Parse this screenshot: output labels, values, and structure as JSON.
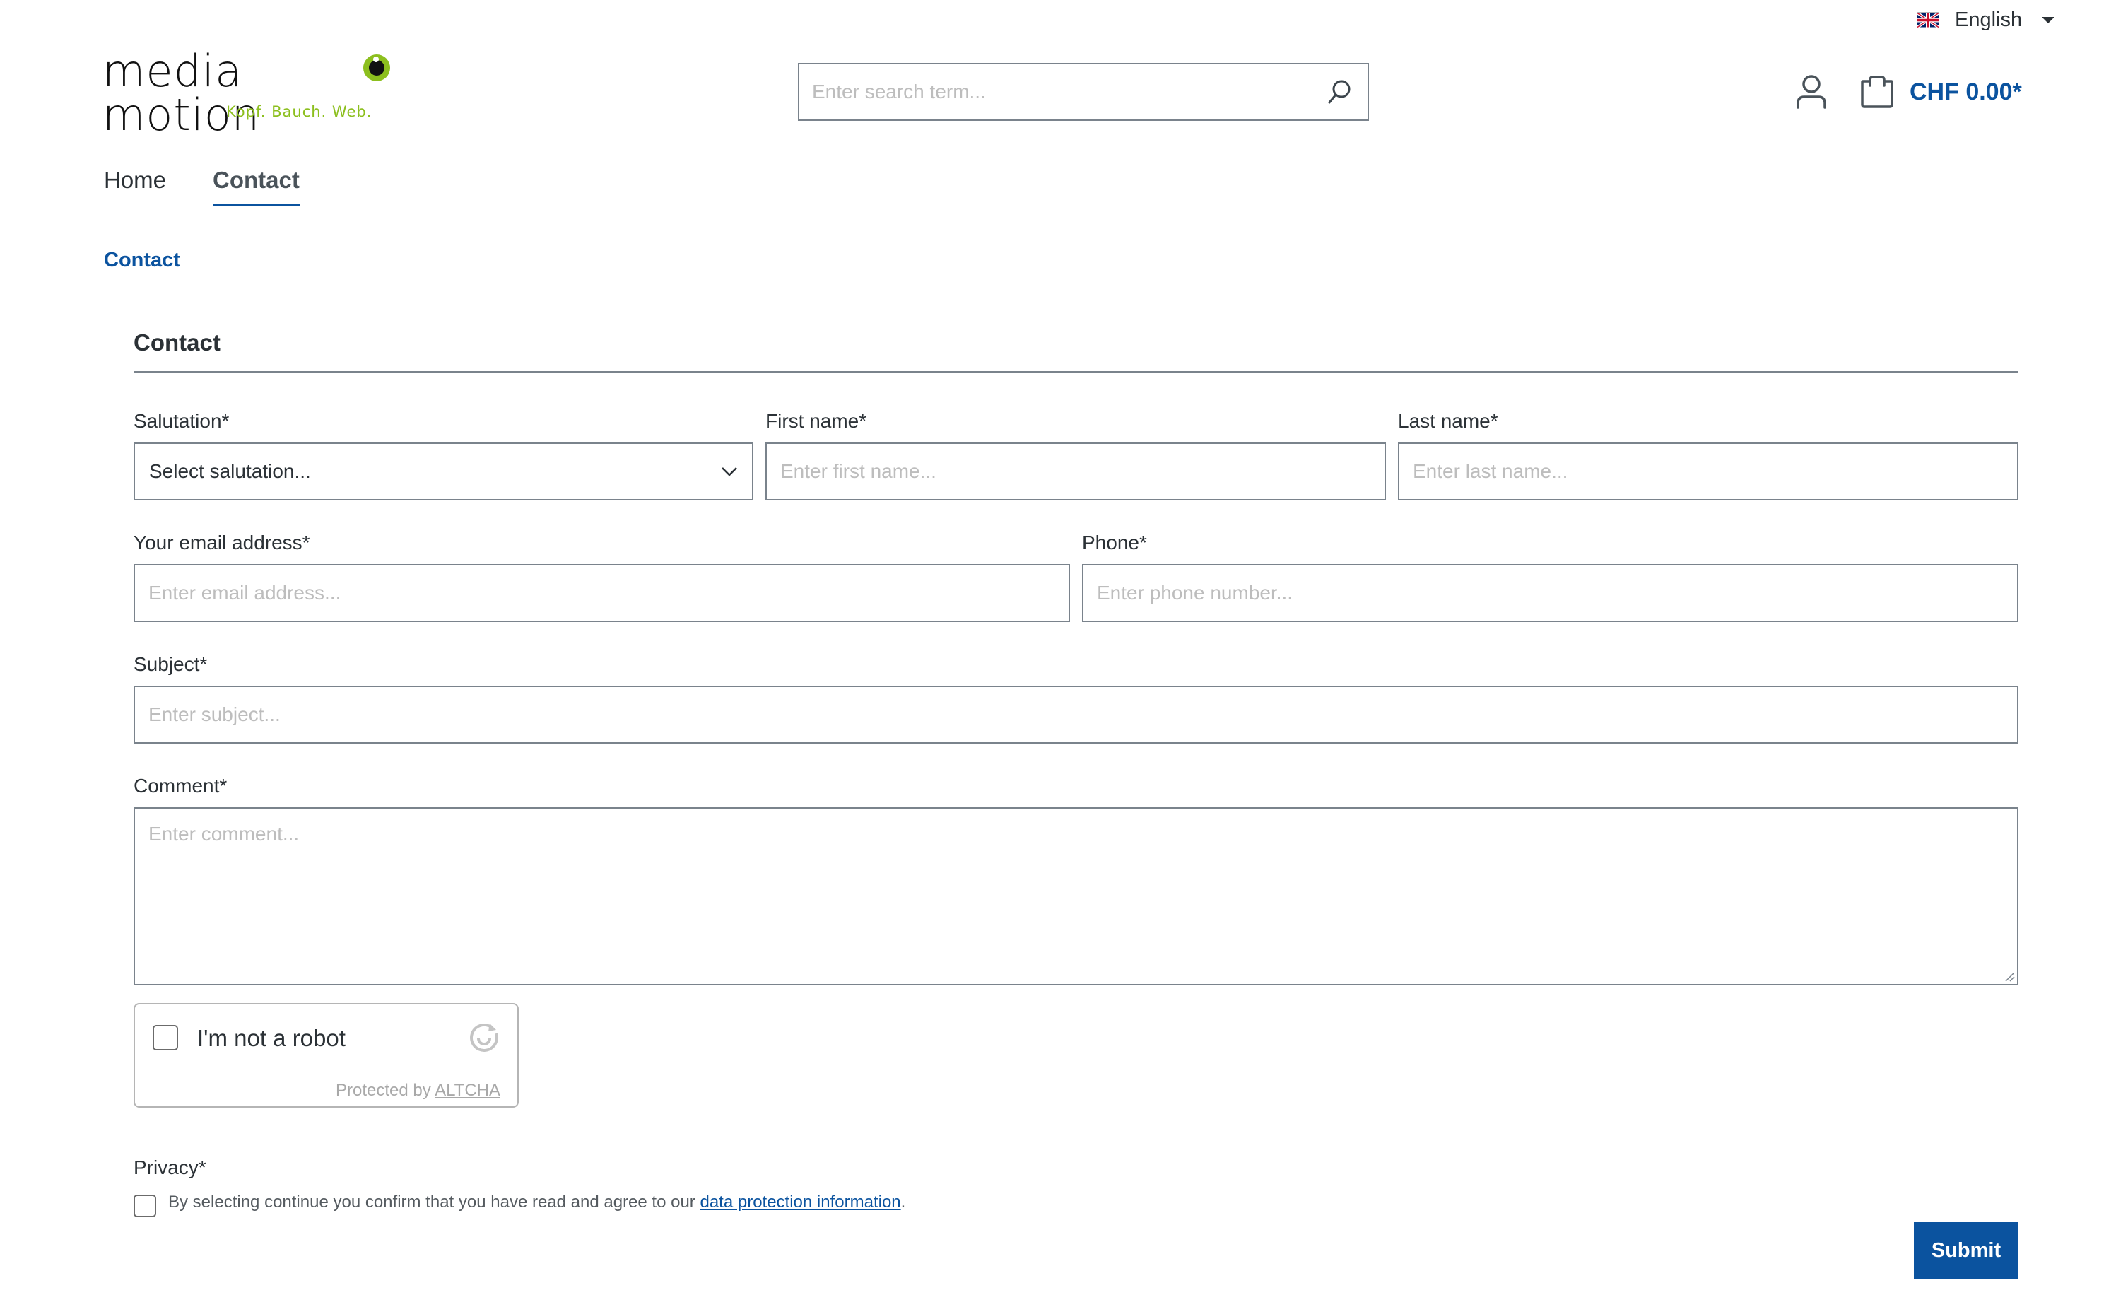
{
  "language": {
    "label": "English",
    "flag": "uk-flag-icon"
  },
  "logo": {
    "wordmark": "media motion",
    "tagline": "Kopf. Bauch. Web."
  },
  "search": {
    "placeholder": "Enter search term..."
  },
  "cart": {
    "total": "CHF 0.00*"
  },
  "nav": {
    "items": [
      {
        "label": "Home",
        "active": false
      },
      {
        "label": "Contact",
        "active": true
      }
    ]
  },
  "breadcrumb": {
    "current": "Contact"
  },
  "form": {
    "heading": "Contact",
    "salutation": {
      "label": "Salutation*",
      "value": "Select salutation..."
    },
    "first_name": {
      "label": "First name*",
      "placeholder": "Enter first name..."
    },
    "last_name": {
      "label": "Last name*",
      "placeholder": "Enter last name..."
    },
    "email": {
      "label": "Your email address*",
      "placeholder": "Enter email address..."
    },
    "phone": {
      "label": "Phone*",
      "placeholder": "Enter phone number..."
    },
    "subject": {
      "label": "Subject*",
      "placeholder": "Enter subject..."
    },
    "comment": {
      "label": "Comment*",
      "placeholder": "Enter comment..."
    },
    "captcha": {
      "label": "I'm not a robot",
      "protected_by": "Protected by",
      "provider": "ALTCHA"
    },
    "privacy": {
      "label": "Privacy*",
      "text_before": "By selecting continue you confirm that you have read and agree to our ",
      "link": "data protection information",
      "text_after": "."
    },
    "submit_label": "Submit"
  },
  "colors": {
    "primary": "#0b539f",
    "brand_green": "#8cbf1e",
    "border": "#7a838c",
    "text": "#2b3136"
  }
}
